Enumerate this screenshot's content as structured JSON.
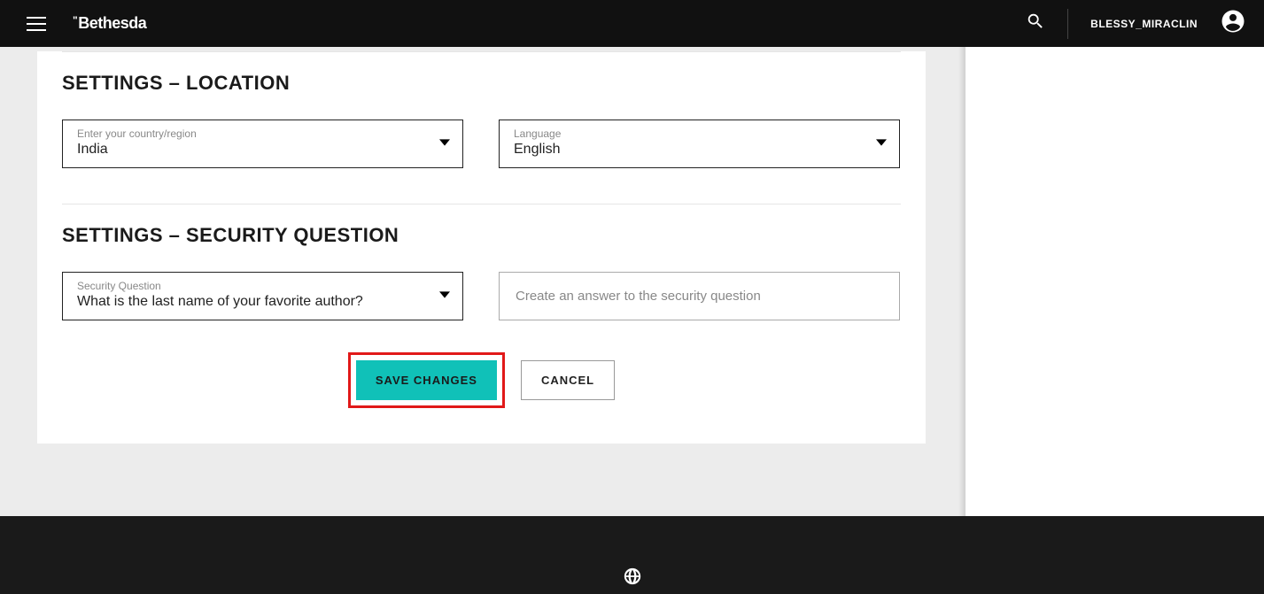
{
  "header": {
    "brand": "Bethesda",
    "username": "BLESSY_MIRACLIN"
  },
  "sections": {
    "location": {
      "heading": "SETTINGS – LOCATION",
      "country_label": "Enter your country/region",
      "country_value": "India",
      "language_label": "Language",
      "language_value": "English"
    },
    "security": {
      "heading": "SETTINGS – SECURITY QUESTION",
      "question_label": "Security Question",
      "question_value": "What is the last name of your favorite author?",
      "answer_placeholder": "Create an answer to the security question"
    }
  },
  "buttons": {
    "save": "SAVE CHANGES",
    "cancel": "CANCEL"
  }
}
